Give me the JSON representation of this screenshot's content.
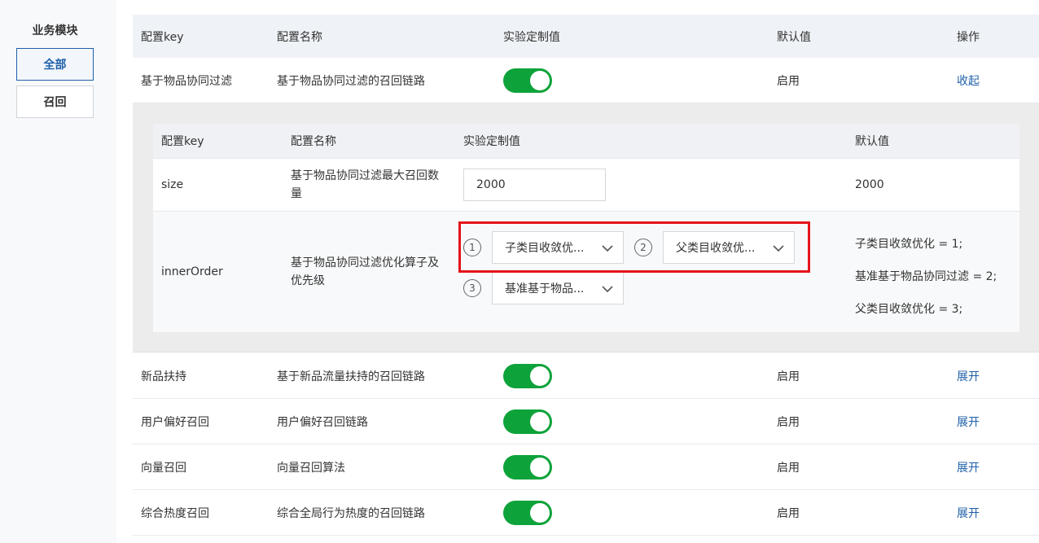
{
  "sidebar": {
    "title": "业务模块",
    "items": [
      {
        "label": "全部",
        "active": true
      },
      {
        "label": "召回",
        "active": false
      }
    ]
  },
  "table": {
    "headers": [
      "配置key",
      "配置名称",
      "实验定制值",
      "默认值",
      "操作"
    ],
    "expanded_row": {
      "key": "基于物品协同过滤",
      "name": "基于物品协同过滤的召回链路",
      "enabled": true,
      "default": "启用",
      "action": "收起"
    },
    "rows": [
      {
        "key": "新品扶持",
        "name": "基于新品流量扶持的召回链路",
        "enabled": true,
        "default": "启用",
        "action": "展开"
      },
      {
        "key": "用户偏好召回",
        "name": "用户偏好召回链路",
        "enabled": true,
        "default": "启用",
        "action": "展开"
      },
      {
        "key": "向量召回",
        "name": "向量召回算法",
        "enabled": true,
        "default": "启用",
        "action": "展开"
      },
      {
        "key": "综合热度召回",
        "name": "综合全局行为热度的召回链路",
        "enabled": true,
        "default": "启用",
        "action": "展开"
      }
    ]
  },
  "inner_table": {
    "headers": [
      "配置key",
      "配置名称",
      "实验定制值",
      "默认值"
    ],
    "size_row": {
      "key": "size",
      "name": "基于物品协同过滤最大召回数量",
      "value": "2000",
      "default": "2000"
    },
    "order_row": {
      "key": "innerOrder",
      "name": "基于物品协同过滤优化算子及优先级",
      "selects": [
        {
          "index": "1",
          "value": "子类目收敛优..."
        },
        {
          "index": "2",
          "value": "父类目收敛优..."
        },
        {
          "index": "3",
          "value": "基准基于物品..."
        }
      ],
      "defaults": [
        "子类目收敛优化 = 1;",
        "基准基于物品协同过滤 = 2;",
        "父类目收敛优化 = 3;"
      ]
    }
  },
  "colors": {
    "accent": "#1e5fa8",
    "toggle_on": "#0ea33a",
    "highlight": "#e4141a"
  }
}
